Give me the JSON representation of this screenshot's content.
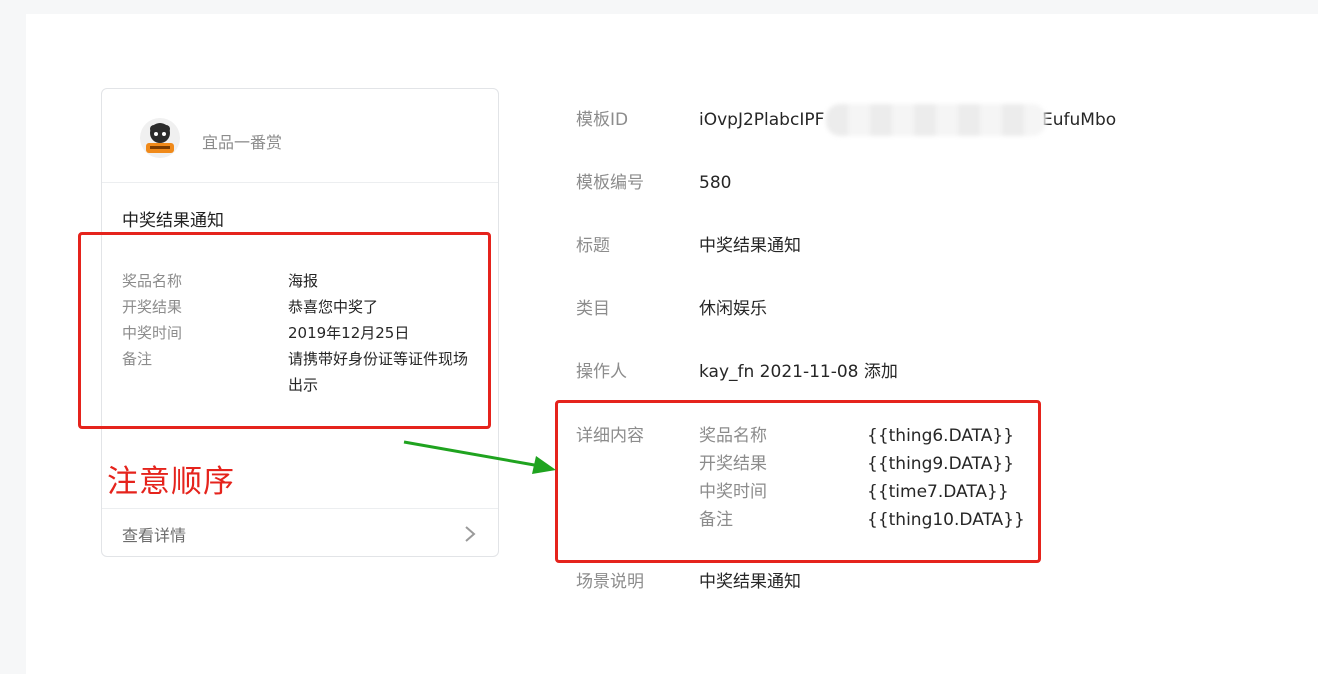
{
  "card": {
    "account_name": "宜品一番赏",
    "avatar_icon": "account-avatar-icon",
    "title": "中奖结果通知",
    "fields": [
      {
        "key": "奖品名称",
        "value": "海报"
      },
      {
        "key": "开奖结果",
        "value": "恭喜您中奖了"
      },
      {
        "key": "中奖时间",
        "value": "2019年12月25日"
      },
      {
        "key": "备注",
        "value": "请携带好身份证等证件现场出示"
      }
    ],
    "view_details": "查看详情"
  },
  "annotation": {
    "note": "注意顺序",
    "highlight_color": "#e5231c",
    "arrow_color": "#1fa31f"
  },
  "info": {
    "template_id": {
      "label": "模板ID",
      "value_start": "iOvpJ2PlabcIPF",
      "value_end": "EufuMbo"
    },
    "template_number": {
      "label": "模板编号",
      "value": "580"
    },
    "title": {
      "label": "标题",
      "value": "中奖结果通知"
    },
    "category": {
      "label": "类目",
      "value": "休闲娱乐"
    },
    "operator": {
      "label": "操作人",
      "value": "kay_fn 2021-11-08 添加"
    },
    "detail": {
      "label": "详细内容",
      "rows": [
        {
          "key": "奖品名称",
          "value": "{{thing6.DATA}}"
        },
        {
          "key": "开奖结果",
          "value": "{{thing9.DATA}}"
        },
        {
          "key": "中奖时间",
          "value": "{{time7.DATA}}"
        },
        {
          "key": "备注",
          "value": "{{thing10.DATA}}"
        }
      ]
    },
    "scene": {
      "label": "场景说明",
      "value": "中奖结果通知"
    }
  }
}
